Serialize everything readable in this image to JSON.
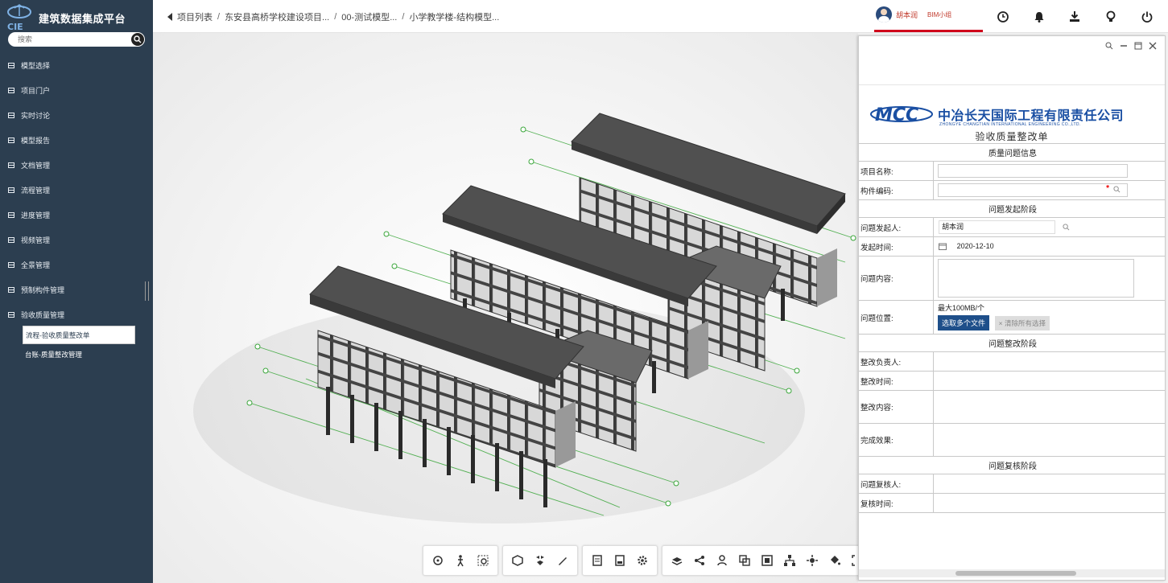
{
  "app": {
    "title": "建筑数据集成平台"
  },
  "search": {
    "placeholder": "搜索"
  },
  "sidebar": {
    "items": [
      {
        "label": "模型选择"
      },
      {
        "label": "项目门户"
      },
      {
        "label": "实时讨论"
      },
      {
        "label": "模型报告"
      },
      {
        "label": "文档管理"
      },
      {
        "label": "流程管理"
      },
      {
        "label": "进度管理"
      },
      {
        "label": "视频管理"
      },
      {
        "label": "全景管理"
      },
      {
        "label": "预制构件管理"
      },
      {
        "label": "验收质量管理"
      }
    ],
    "subitems": [
      {
        "label": "流程-验收质量整改单"
      },
      {
        "label": "台账-质量整改管理"
      }
    ]
  },
  "breadcrumb": {
    "items": [
      "项目列表",
      "东安县高桥学校建设项目...",
      "00-测试模型...",
      "小学教学楼-结构模型..."
    ],
    "separator": "/"
  },
  "header": {
    "user_name": "胡本润",
    "user_role": "BIM小组",
    "accent_color": "#d0021b"
  },
  "panel": {
    "company_cn": "中冶长天国际工程有限责任公司",
    "company_en": "ZHONGYE CHANGTIAN INTERNATIONAL ENGINEERING CO.,LTD.",
    "logo_text": "MCC",
    "form_title": "验收质量整改单",
    "sections": {
      "info": "质量问题信息",
      "raise": "问题发起阶段",
      "rectify": "问题整改阶段",
      "review": "问题复核阶段"
    },
    "labels": {
      "project_name": "项目名称:",
      "component_code": "构件编码:",
      "initiator": "问题发起人:",
      "raise_time": "发起时间:",
      "issue_content": "问题内容:",
      "issue_location": "问题位置:",
      "rectify_owner": "整改负责人:",
      "rectify_time": "整改时间:",
      "rectify_content": "整改内容:",
      "result": "完成效果:",
      "reviewer": "问题复核人:",
      "review_time": "复核时间:"
    },
    "values": {
      "initiator": "胡本润",
      "raise_time": "2020-12-10",
      "required_mark": "*",
      "upload_limit": "最大100MB/个",
      "upload_button": "选取多个文件",
      "clear_button": "× 清除所有选择"
    }
  }
}
